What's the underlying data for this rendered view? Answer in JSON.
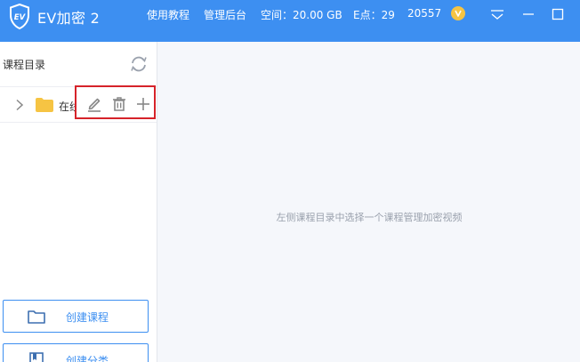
{
  "app": {
    "title": "EV加密 2",
    "logo_icon": "ev-shield-logo",
    "accent_color": "#3d8ff1"
  },
  "header": {
    "nav": [
      "使用教程",
      "管理后台"
    ],
    "space": "空间：20.00 GB",
    "epoints": "E点：29",
    "account": "20557",
    "badge_icon": "vip-badge-icon",
    "window_controls": [
      "dropdown-icon",
      "minimize-icon",
      "maximize-icon"
    ]
  },
  "sidebar": {
    "title": "课程目录",
    "refresh_icon": "refresh-icon",
    "items": [
      {
        "label": "在线",
        "icon": "folder-icon",
        "expanded": false
      }
    ],
    "item_actions": [
      "edit-icon",
      "delete-icon",
      "add-icon"
    ],
    "highlight_color": "#d6232a",
    "buttons": [
      {
        "label": "创建课程",
        "icon": "folder-outline-icon"
      },
      {
        "label": "创建分类",
        "icon": "bookmark-icon"
      }
    ]
  },
  "main": {
    "hint": "左侧课程目录中选择一个课程管理加密视频"
  }
}
